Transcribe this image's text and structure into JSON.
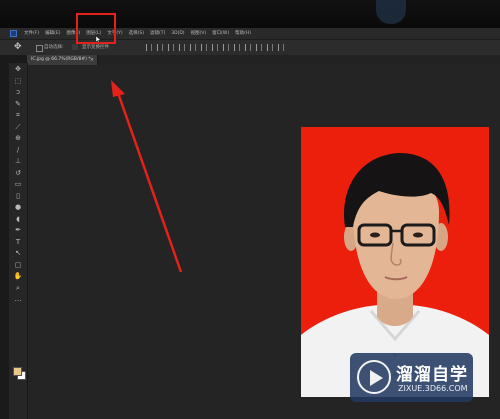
{
  "app": {
    "menu_items": [
      "文件(F)",
      "编辑(E)",
      "图像(I)",
      "图层(L)",
      "文字(Y)",
      "选择(S)",
      "滤镜(T)",
      "3D(D)",
      "视图(V)",
      "窗口(W)",
      "帮助(H)"
    ],
    "highlighted_menu": "图层(L)",
    "accent_color": "#e4221b"
  },
  "options_bar": {
    "auto_select_label": "自动选择:",
    "show_transform_label": "显示变换控件"
  },
  "document": {
    "tab_label": "IC.jpg @ 66.7%(RGB/8#) *",
    "tab_close": "×",
    "photo_background_color": "#ec1f0d"
  },
  "tools": [
    "move-icon",
    "marquee-icon",
    "lasso-icon",
    "quick-select-icon",
    "crop-icon",
    "eyedropper-icon",
    "healing-icon",
    "brush-icon",
    "stamp-icon",
    "history-brush-icon",
    "eraser-icon",
    "gradient-icon",
    "blur-icon",
    "dodge-icon",
    "pen-icon",
    "type-icon",
    "path-select-icon",
    "shape-icon",
    "hand-icon",
    "zoom-icon"
  ],
  "watermark": {
    "title": "溜溜自学",
    "subtitle": "ZIXUE.3D66.COM",
    "brand_color": "#223a61"
  }
}
